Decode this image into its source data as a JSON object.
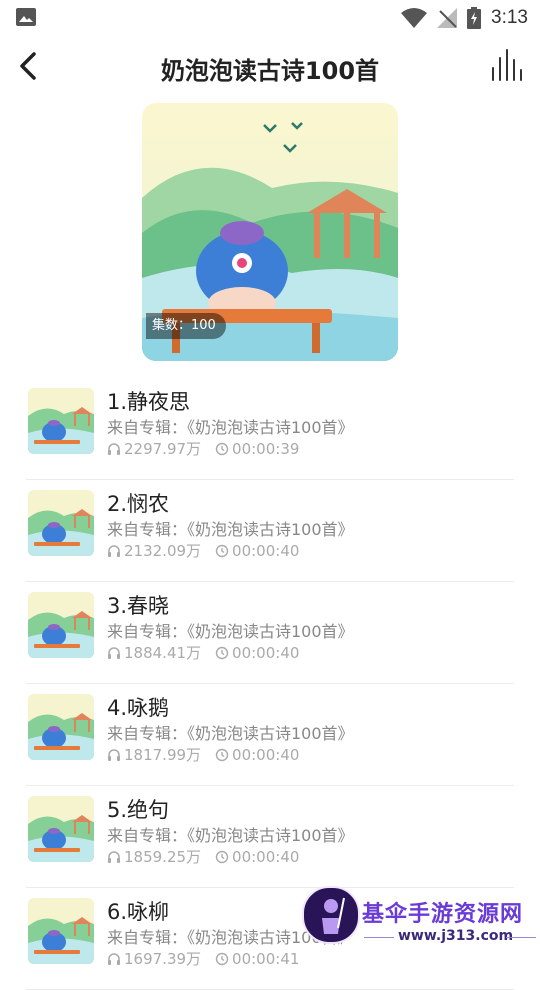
{
  "status_bar": {
    "time": "3:13"
  },
  "header": {
    "title": "奶泡泡读古诗100首"
  },
  "cover": {
    "episode_count": "集数：100"
  },
  "list": {
    "items": [
      {
        "title": "1.静夜思",
        "album": "来自专辑：《奶泡泡读古诗100首》",
        "plays": "2297.97万",
        "duration": "00:00:39"
      },
      {
        "title": "2.悯农",
        "album": "来自专辑：《奶泡泡读古诗100首》",
        "plays": "2132.09万",
        "duration": "00:00:40"
      },
      {
        "title": "3.春晓",
        "album": "来自专辑：《奶泡泡读古诗100首》",
        "plays": "1884.41万",
        "duration": "00:00:40"
      },
      {
        "title": "4.咏鹅",
        "album": "来自专辑：《奶泡泡读古诗100首》",
        "plays": "1817.99万",
        "duration": "00:00:40"
      },
      {
        "title": "5.绝句",
        "album": "来自专辑：《奶泡泡读古诗100首》",
        "plays": "1859.25万",
        "duration": "00:00:40"
      },
      {
        "title": "6.咏柳",
        "album": "来自专辑：《奶泡泡读古诗100首》",
        "plays": "1697.39万",
        "duration": "00:00:41"
      }
    ]
  },
  "watermark": {
    "name": "基伞手游资源网",
    "url": "www.j313.com"
  },
  "icons": {
    "back": "chevron-left-icon",
    "now_playing": "audio-bars-icon",
    "plays": "headphones-icon",
    "duration": "clock-icon"
  },
  "colors": {
    "title": "#222222",
    "secondary": "#888888",
    "meta": "#aaaaaa",
    "divider": "#ececec"
  }
}
